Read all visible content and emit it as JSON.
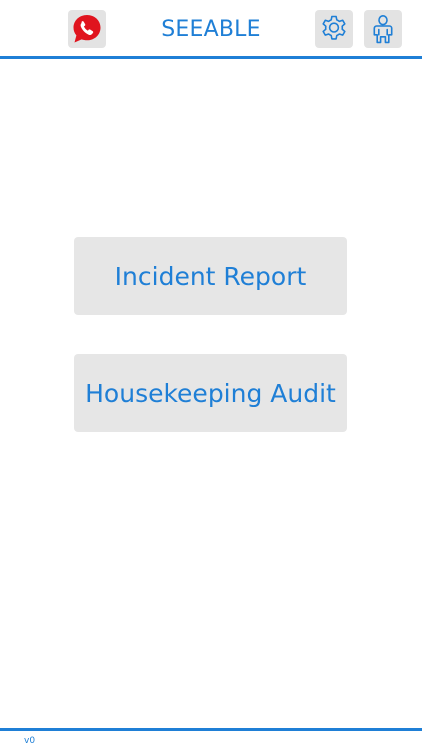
{
  "header": {
    "title": "SEEABLE",
    "call_icon": "phone-icon",
    "settings_icon": "gear-icon",
    "profile_icon": "user-icon"
  },
  "main": {
    "buttons": [
      {
        "label": "Incident Report"
      },
      {
        "label": "Housekeeping Audit"
      }
    ]
  },
  "footer": {
    "version": "v0"
  },
  "colors": {
    "accent": "#1f7fd6",
    "button_bg": "#e6e6e6",
    "call_red": "#e0141e"
  }
}
